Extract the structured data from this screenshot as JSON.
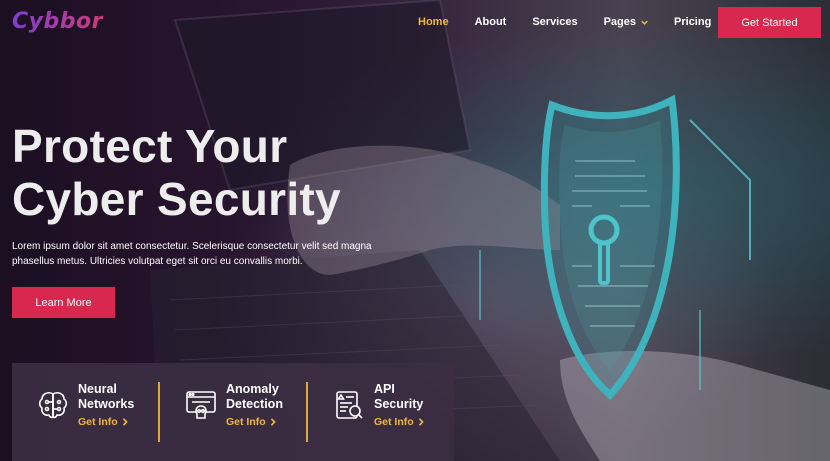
{
  "brand": {
    "logo_text": "Cybbor"
  },
  "nav": {
    "items": [
      {
        "label": "Home",
        "active": true
      },
      {
        "label": "About",
        "active": false
      },
      {
        "label": "Services",
        "active": false
      },
      {
        "label": "Pages",
        "active": false,
        "has_dropdown": true
      },
      {
        "label": "Pricing",
        "active": false
      }
    ],
    "cta_label": "Get Started"
  },
  "hero": {
    "title_line1": "Protect Your",
    "title_line2": "Cyber Security",
    "description": "Lorem ipsum dolor sit amet consectetur. Scelerisque consectetur velit sed magna phasellus metus. Ultricies volutpat eget sit orci eu convallis morbi.",
    "button_label": "Learn More"
  },
  "features": [
    {
      "title_line1": "Neural",
      "title_line2": "Networks",
      "link_label": "Get Info",
      "icon": "brain-icon"
    },
    {
      "title_line1": "Anomaly",
      "title_line2": "Detection",
      "link_label": "Get Info",
      "icon": "skull-browser-icon"
    },
    {
      "title_line1": "API",
      "title_line2": "Security",
      "link_label": "Get Info",
      "icon": "document-search-icon"
    }
  ],
  "colors": {
    "accent": "#d8284f",
    "highlight": "#f2b640",
    "brand_gradient": [
      "#7a3fd0",
      "#d23a7a"
    ]
  }
}
